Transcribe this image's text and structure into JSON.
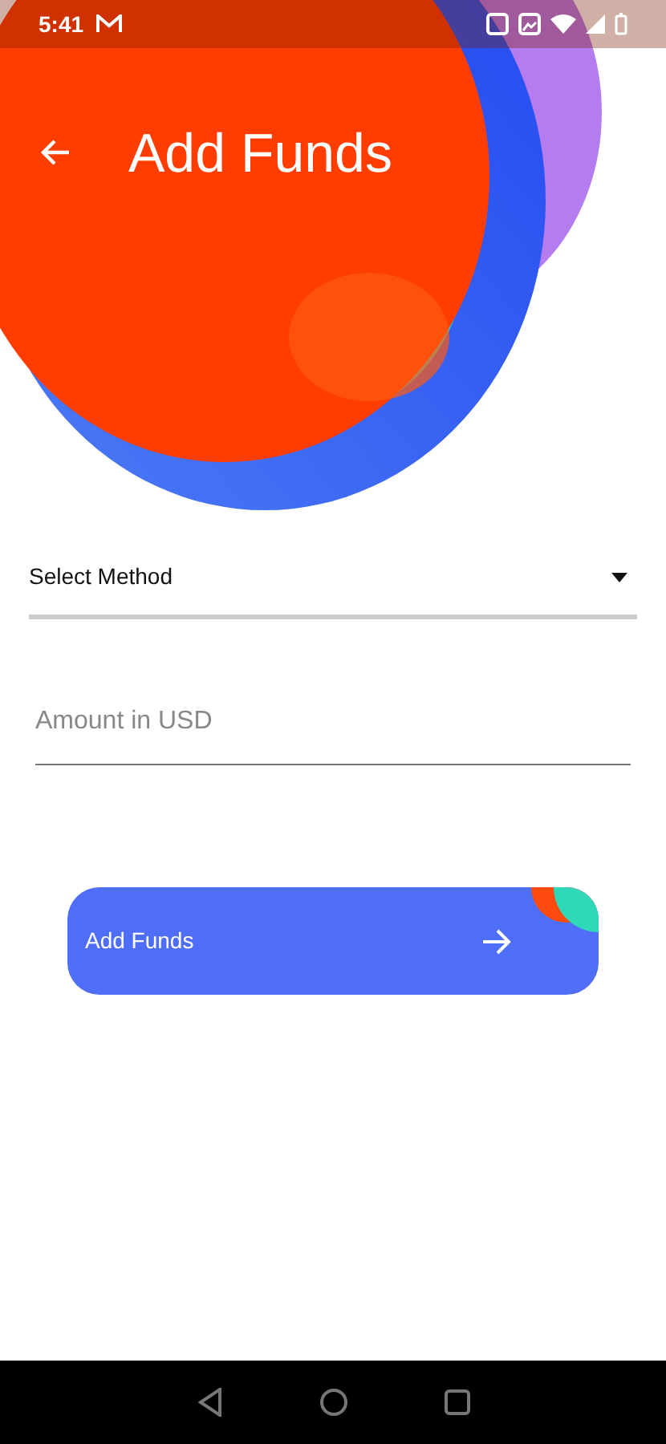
{
  "status_bar": {
    "time": "5:41"
  },
  "header": {
    "title": "Add Funds"
  },
  "form": {
    "method_select": {
      "label": "Select Method"
    },
    "amount": {
      "placeholder": "Amount in USD"
    },
    "submit": {
      "label": "Add Funds"
    }
  }
}
